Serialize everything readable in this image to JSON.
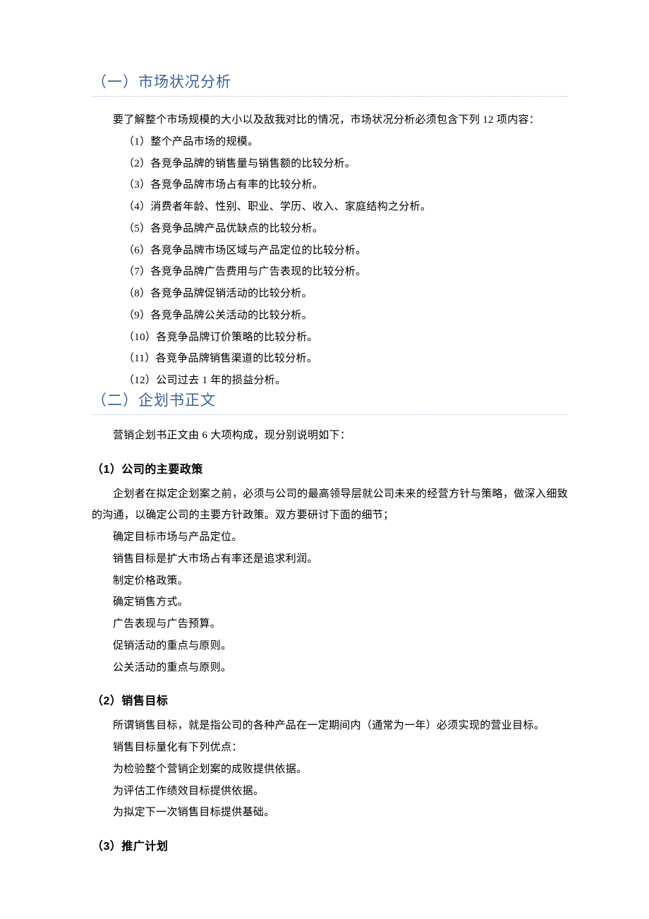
{
  "section1": {
    "heading": "（一）市场状况分析",
    "intro": "要了解整个市场规模的大小以及敌我对比的情况，市场状况分析必须包含下列 12 项内容：",
    "items": [
      "（1）整个产品市场的规模。",
      "（2）各竞争品牌的销售量与销售额的比较分析。",
      "（3）各竞争品牌市场占有率的比较分析。",
      "（4）消费者年龄、性别、职业、学历、收入、家庭结构之分析。",
      "（5）各竞争品牌产品优缺点的比较分析。",
      "（6）各竞争品牌市场区域与产品定位的比较分析。",
      "（7）各竞争品牌广告费用与广告表现的比较分析。",
      "（8）各竞争品牌促销活动的比较分析。",
      "（9）各竞争品牌公关活动的比较分析。",
      "（10）各竞争品牌订价策略的比较分析。",
      "（11）各竞争品牌销售渠道的比较分析。",
      "（12）公司过去 1 年的损益分析。"
    ]
  },
  "section2": {
    "heading": "（二）企划书正文",
    "intro": "营销企划书正文由 6 大项构成，现分别说明如下：",
    "sub1": {
      "heading": "（1）公司的主要政策",
      "p": "企划者在拟定企划案之前，必须与公司的最高领导层就公司未来的经营方针与策略，做深入细致的沟通，以确定公司的主要方针政策。双方要研讨下面的细节；",
      "items": [
        "确定目标市场与产品定位。",
        "销售目标是扩大市场占有率还是追求利润。",
        "制定价格政策。",
        "确定销售方式。",
        "广告表现与广告预算。",
        "促销活动的重点与原则。",
        "公关活动的重点与原则。"
      ]
    },
    "sub2": {
      "heading": "（2）销售目标",
      "p": "所谓销售目标，就是指公司的各种产品在一定期间内（通常为一年）必须实现的营业目标。",
      "p2": "销售目标量化有下列优点：",
      "items": [
        "为检验整个营销企划案的成败提供依据。",
        "为评估工作绩效目标提供依据。",
        "为拟定下一次销售目标提供基础。"
      ]
    },
    "sub3": {
      "heading": "（3）推广计划"
    }
  }
}
